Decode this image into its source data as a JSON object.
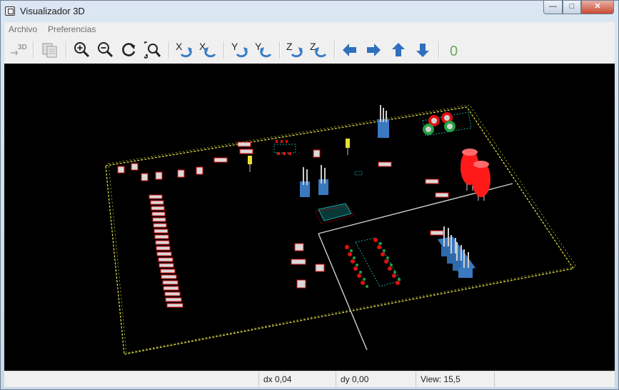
{
  "window": {
    "title": "Visualizador 3D",
    "close_glyph": "✕",
    "minimize_glyph": "—",
    "maximize_glyph": "□"
  },
  "menu": {
    "items": [
      "Archivo",
      "Preferencias"
    ]
  },
  "toolbar": {
    "tools": [
      "export-3d-icon",
      "copy-image-icon",
      "zoom-in-icon",
      "zoom-out-icon",
      "redraw-icon",
      "zoom-fit-icon",
      "rotate-x-cw-icon",
      "rotate-x-ccw-icon",
      "rotate-y-cw-icon",
      "rotate-y-ccw-icon",
      "rotate-z-cw-icon",
      "rotate-z-ccw-icon",
      "pan-left-icon",
      "pan-right-icon",
      "pan-up-icon",
      "pan-down-icon",
      "ortho-toggle-icon"
    ],
    "export_label": "3D",
    "axis_x": "X",
    "axis_y": "Y",
    "axis_z": "Z",
    "ortho_label": "0"
  },
  "status": {
    "dx": "dx 0,04",
    "dy": "dy 0,00",
    "view": "View: 15,5"
  },
  "colors": {
    "board_outline": "#e8e84a",
    "axis": "#d0d0d0",
    "pad": "#e01010",
    "led": "#ff1a1a",
    "header": "#3a78c0"
  }
}
